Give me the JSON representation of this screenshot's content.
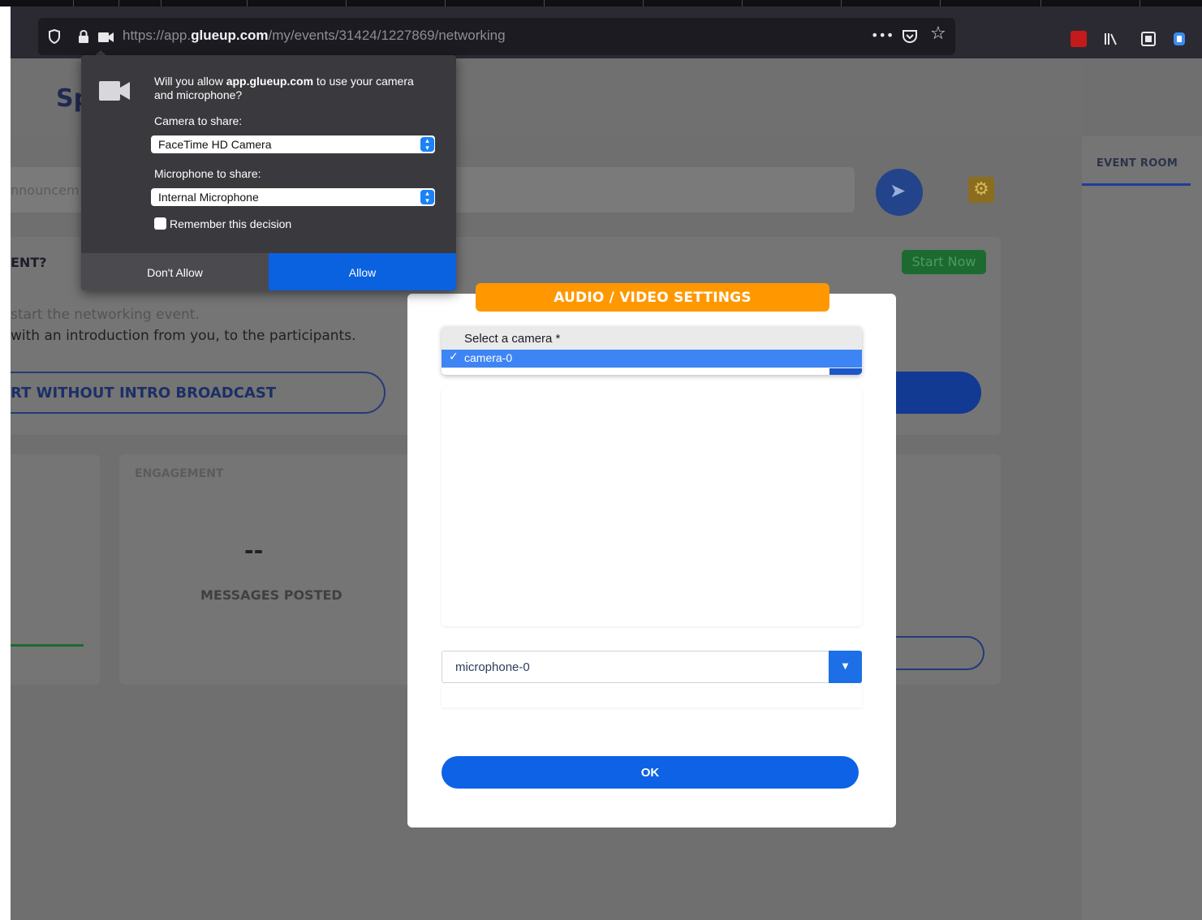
{
  "browser": {
    "url_prefix": "https://app.",
    "url_domain": "glueup.com",
    "url_path": "/my/events/31424/1227869/networking",
    "overflow_icon": "•••",
    "pocket_icon": "pocket-icon",
    "bookmark_icon": "☆",
    "extension_icons": [
      "pdf-extension-icon",
      "library-icon",
      "reader-icon",
      "account-icon"
    ]
  },
  "page": {
    "title_partial": "Sp",
    "announce_placeholder": "nnouncem",
    "sidebar_tab": "EVENT ROOM",
    "start_question": "ENT?",
    "start_now_label": "Start Now",
    "start_text_line1": "start the networking event.",
    "start_text_line2": "with an introduction from you, to the participants.",
    "start_without_label": "RT WITHOUT INTRO BROADCAST",
    "engagement_title": "ENGAGEMENT",
    "engagement_value": "--",
    "engagement_label": "MESSAGES POSTED"
  },
  "modal": {
    "header": "AUDIO / VIDEO SETTINGS",
    "camera_label": "Select a camera *",
    "camera_check": "✓",
    "camera_selected": "camera-0",
    "microphone_selected": "microphone-0",
    "ok_label": "OK"
  },
  "permission": {
    "question_prefix": "Will you allow ",
    "question_domain": "app.glueup.com",
    "question_suffix": " to use your camera and microphone?",
    "camera_label": "Camera to share:",
    "camera_value": "FaceTime HD Camera",
    "mic_label": "Microphone to share:",
    "mic_value": "Internal Microphone",
    "remember_label": "Remember this decision",
    "dont_allow_label": "Don't Allow",
    "allow_label": "Allow"
  },
  "colors": {
    "modal_header": "#ff9800",
    "primary_blue": "#0d62e6",
    "permission_bg": "#3a3a3e",
    "permission_allow": "#0a62e0"
  }
}
